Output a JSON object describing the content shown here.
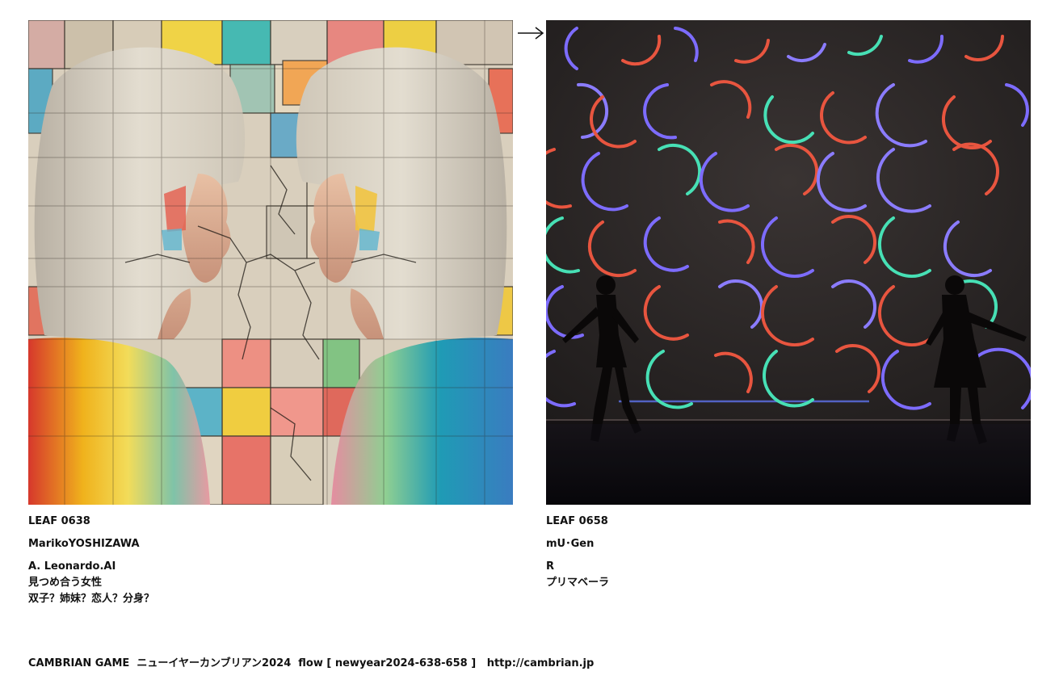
{
  "left": {
    "id": "LEAF 0638",
    "author": "MarikoYOSHIZAWA",
    "category": "A. Leonardo.AI",
    "title": "見つめ合う女性",
    "comment": "双子？姉妹？恋人？分身？"
  },
  "right": {
    "id": "LEAF 0658",
    "author": "mU･Gen",
    "category": "R",
    "title": "プリマベーラ"
  },
  "footer": {
    "text": "CAMBRIAN GAME  ニューイヤーカンブリアン2024  flow [ newyear2024-638-658 ]   http://cambrian.jp"
  },
  "icons": {
    "flow_arrow": "right-arrow-icon"
  }
}
